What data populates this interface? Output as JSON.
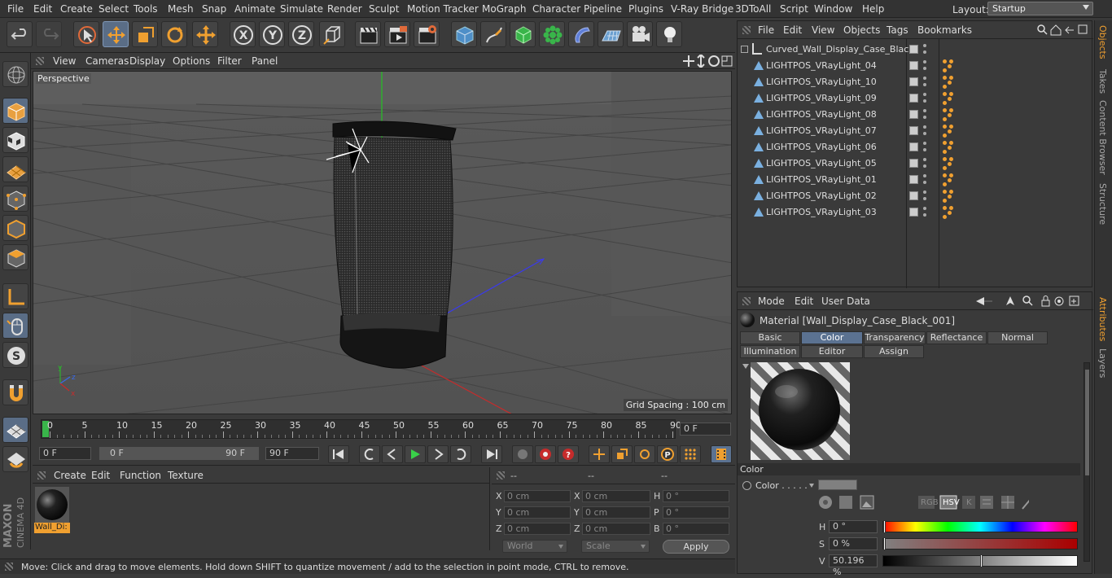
{
  "menubar": {
    "items": [
      "File",
      "Edit",
      "Create",
      "Select",
      "Tools",
      "Mesh",
      "Snap",
      "Animate",
      "Simulate",
      "Render",
      "Sculpt",
      "Motion Tracker",
      "MoGraph",
      "Character",
      "Pipeline",
      "Plugins",
      "V-Ray Bridge",
      "3DToAll",
      "Script",
      "Window",
      "Help"
    ],
    "layout_label": "Layout:",
    "layout_value": "Startup"
  },
  "viewport": {
    "menu": [
      "View",
      "Cameras",
      "Display",
      "Options",
      "Filter",
      "Panel"
    ],
    "camera_label": "Perspective",
    "grid_spacing": "Grid Spacing : 100 cm"
  },
  "timeline": {
    "ticks": [
      "0",
      "5",
      "10",
      "15",
      "20",
      "25",
      "30",
      "35",
      "40",
      "45",
      "50",
      "55",
      "60",
      "65",
      "70",
      "75",
      "80",
      "85",
      "90"
    ],
    "current_frame": "0 F",
    "start_field": "0 F",
    "range_start": "0 F",
    "range_end": "90 F",
    "end_field": "90 F"
  },
  "material_manager": {
    "menu": [
      "Create",
      "Edit",
      "Function",
      "Texture"
    ],
    "material_name": "Wall_Di:"
  },
  "coordinates": {
    "header": [
      "--",
      "--",
      "--"
    ],
    "rows": [
      {
        "l1": "X",
        "v1": "0 cm",
        "l2": "X",
        "v2": "0 cm",
        "l3": "H",
        "v3": "0 °"
      },
      {
        "l1": "Y",
        "v1": "0 cm",
        "l2": "Y",
        "v2": "0 cm",
        "l3": "P",
        "v3": "0 °"
      },
      {
        "l1": "Z",
        "v1": "0 cm",
        "l2": "Z",
        "v2": "0 cm",
        "l3": "B",
        "v3": "0 °"
      }
    ],
    "mode1": "World",
    "mode2": "Scale",
    "apply": "Apply"
  },
  "status": "Move: Click and drag to move elements. Hold down SHIFT to quantize movement / add to the selection in point mode, CTRL to remove.",
  "object_manager": {
    "menu": [
      "File",
      "Edit",
      "View",
      "Objects",
      "Tags",
      "Bookmarks"
    ],
    "objects": [
      "Curved_Wall_Display_Case_Black",
      "LIGHTPOS_VRayLight_04",
      "LIGHTPOS_VRayLight_10",
      "LIGHTPOS_VRayLight_09",
      "LIGHTPOS_VRayLight_08",
      "LIGHTPOS_VRayLight_07",
      "LIGHTPOS_VRayLight_06",
      "LIGHTPOS_VRayLight_05",
      "LIGHTPOS_VRayLight_01",
      "LIGHTPOS_VRayLight_02",
      "LIGHTPOS_VRayLight_03"
    ]
  },
  "right_tabs": {
    "top": [
      "Objects",
      "Takes",
      "Content Browser",
      "Structure"
    ],
    "bottom": [
      "Attributes",
      "Layers"
    ]
  },
  "attributes": {
    "menu": [
      "Mode",
      "Edit",
      "User Data"
    ],
    "title": "Material [Wall_Display_Case_Black_001]",
    "tabs_row1": [
      "Basic",
      "Color",
      "Transparency",
      "Reflectance",
      "Normal"
    ],
    "tabs_row2": [
      "Illumination",
      "Editor",
      "Assign"
    ],
    "active_tab": "Color",
    "section": "Color",
    "color_label": "Color . . . . .",
    "mode_buttons": [
      "RGB",
      "HSV",
      "K"
    ],
    "h_label": "H",
    "h_value": "0 °",
    "s_label": "S",
    "s_value": "0 %",
    "v_label": "V",
    "v_value": "50.196 %",
    "v_fraction": 0.50196
  },
  "colors": {
    "accent": "#f0a030",
    "selection_blue": "#5b7291"
  }
}
